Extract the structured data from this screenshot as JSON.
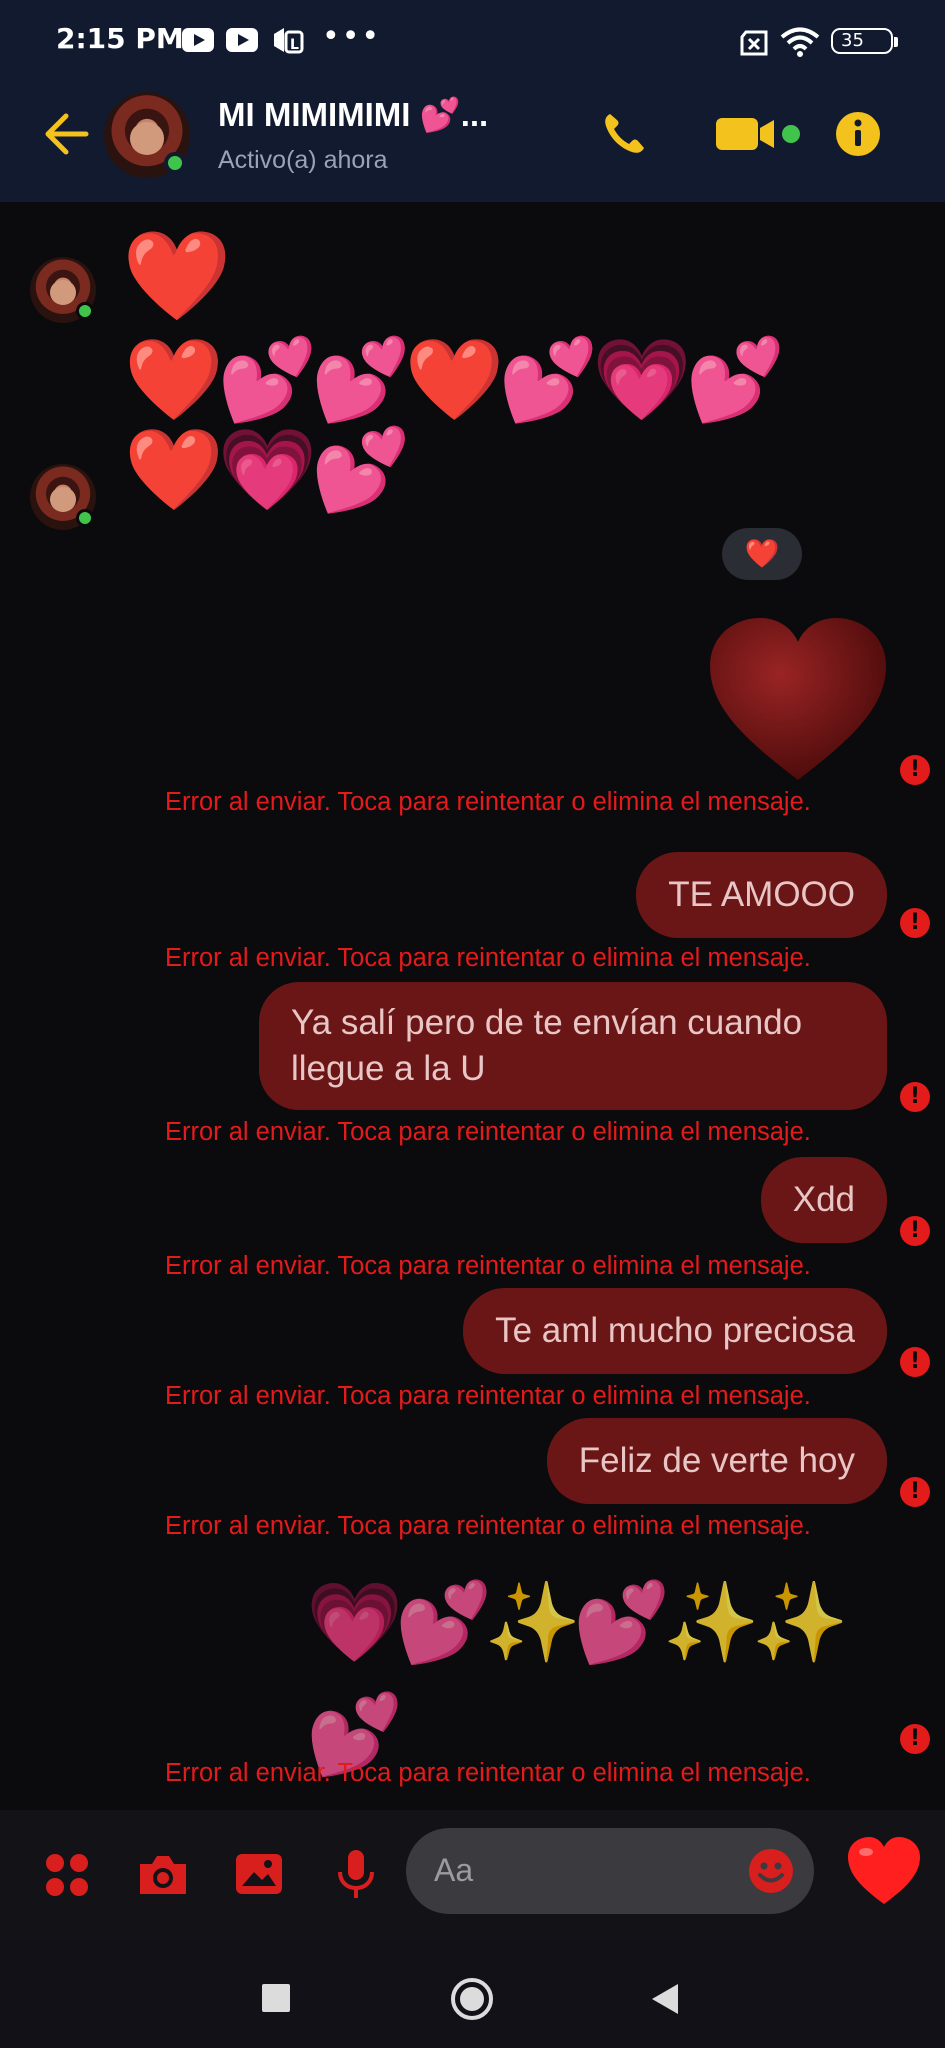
{
  "status_bar": {
    "time": "2:15 PM",
    "more": "•••",
    "battery": "35"
  },
  "header": {
    "contact_name": "MI MIMIMIMI 💕...",
    "contact_status": "Activo(a) ahora",
    "accent": "#f4c21c",
    "icons": [
      "back-arrow-icon",
      "phone-icon",
      "video-call-icon",
      "info-icon"
    ]
  },
  "chat": {
    "received": [
      {
        "emoji": "❤️"
      },
      {
        "emoji": "❤️💕💕❤️💕💗💕"
      },
      {
        "emoji": "❤️💗💕"
      }
    ],
    "reaction": "❤️",
    "sent": [
      {
        "type": "emoji",
        "text": "❤️"
      },
      {
        "type": "text",
        "text": "TE AMOOO"
      },
      {
        "type": "text",
        "text": "Ya salí pero de te envían cuando llegue a la U"
      },
      {
        "type": "text",
        "text": "Xdd"
      },
      {
        "type": "text",
        "text": "Te aml mucho preciosa"
      },
      {
        "type": "text",
        "text": "Feliz de verte hoy"
      },
      {
        "type": "emoji",
        "text": "💗💕✨💕✨✨💕"
      }
    ],
    "error_text": "Error al enviar. Toca para reintentar o elimina el mensaje.",
    "error_color": "#e31b1b",
    "bubble_color": "#6b1616"
  },
  "composer": {
    "placeholder": "Aa",
    "accent": "#d91e1e",
    "icons": [
      "apps-icon",
      "camera-icon",
      "image-icon",
      "microphone-icon",
      "emoji-icon",
      "heart-like-icon"
    ]
  },
  "navbar": {
    "icons": [
      "recents-square-icon",
      "home-circle-icon",
      "back-triangle-icon"
    ]
  }
}
